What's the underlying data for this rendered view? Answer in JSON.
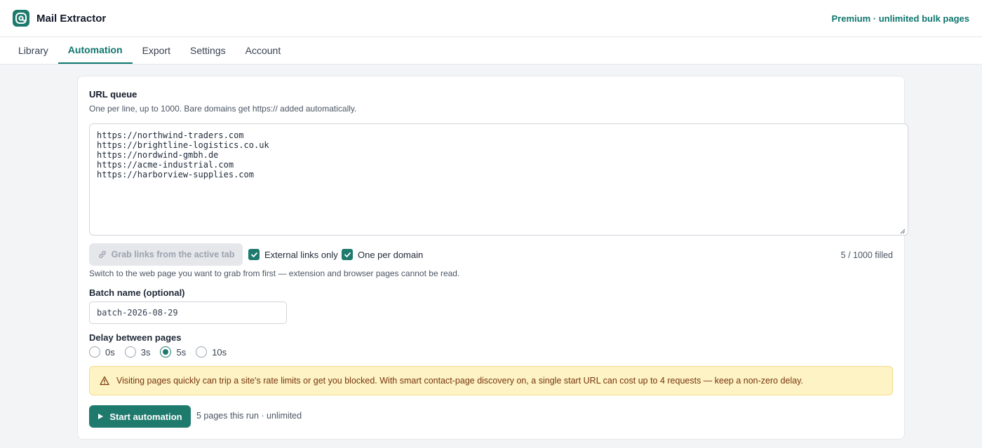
{
  "app": {
    "title": "Mail Extractor",
    "plan": "Premium · unlimited bulk pages",
    "accent": "#1f7a6e"
  },
  "tabs": [
    {
      "label": "Library",
      "active": false
    },
    {
      "label": "Automation",
      "active": true
    },
    {
      "label": "Export",
      "active": false
    },
    {
      "label": "Settings",
      "active": false
    },
    {
      "label": "Account",
      "active": false
    }
  ],
  "queue": {
    "title": "URL queue",
    "subtitle": "One per line, up to 1000. Bare domains get https:// added automatically.",
    "urls": "https://northwind-traders.com\nhttps://brightline-logistics.co.uk\nhttps://nordwind-gmbh.de\nhttps://acme-industrial.com\nhttps://harborview-supplies.com",
    "grab_button": "Grab links from the active tab",
    "external_only_label": "External links only",
    "external_only_checked": true,
    "one_per_domain_label": "One per domain",
    "one_per_domain_checked": true,
    "filled_count": "5 / 1000 filled",
    "hint": "Switch to the web page you want to grab from first — extension and browser pages cannot be read."
  },
  "batch": {
    "label": "Batch name (optional)",
    "value": "batch-2026-08-29"
  },
  "delay": {
    "label": "Delay between pages",
    "options": [
      "0s",
      "3s",
      "5s",
      "10s"
    ],
    "selected": "5s"
  },
  "warning": {
    "text": "Visiting pages quickly can trip a site's rate limits or get you blocked. With smart contact-page discovery on, a single start URL can cost up to 4 requests — keep a non-zero delay."
  },
  "run": {
    "start_label": "Start automation",
    "info": "5 pages this run · unlimited"
  }
}
